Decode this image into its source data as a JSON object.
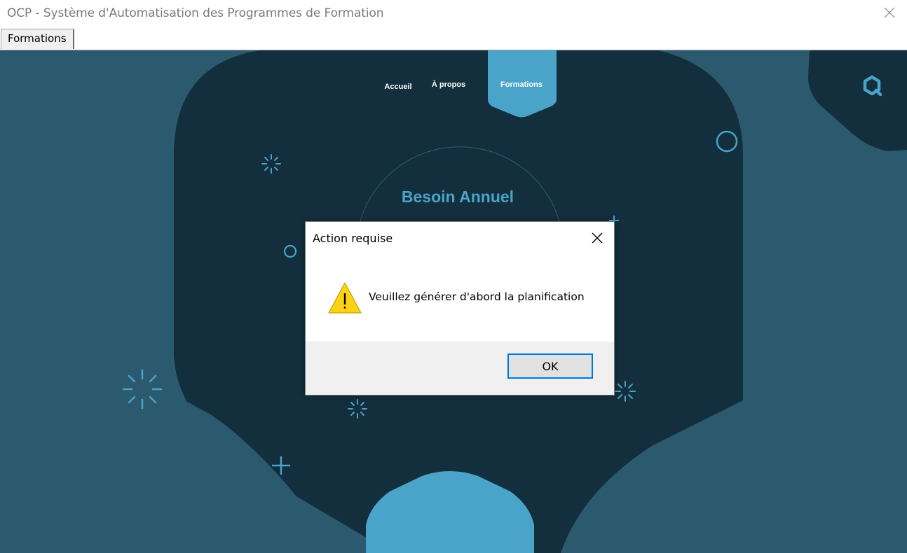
{
  "window": {
    "title": "OCP - Système d'Automatisation des Programmes de Formation"
  },
  "tabs": [
    {
      "label": "Formations"
    }
  ],
  "nav": {
    "home": "Accueil",
    "about": "À propos",
    "active": "Formations"
  },
  "main": {
    "heading": "Besoin Annuel"
  },
  "dialog": {
    "title": "Action requise",
    "message": "Veuillez générer d'abord la planification",
    "ok_label": "OK"
  },
  "colors": {
    "background_mid": "#2b5a6f",
    "background_dark": "#132e3c",
    "accent": "#4aa3c9",
    "focus": "#0078d7"
  },
  "icons": [
    "close-icon",
    "search-icon",
    "warning-icon"
  ]
}
